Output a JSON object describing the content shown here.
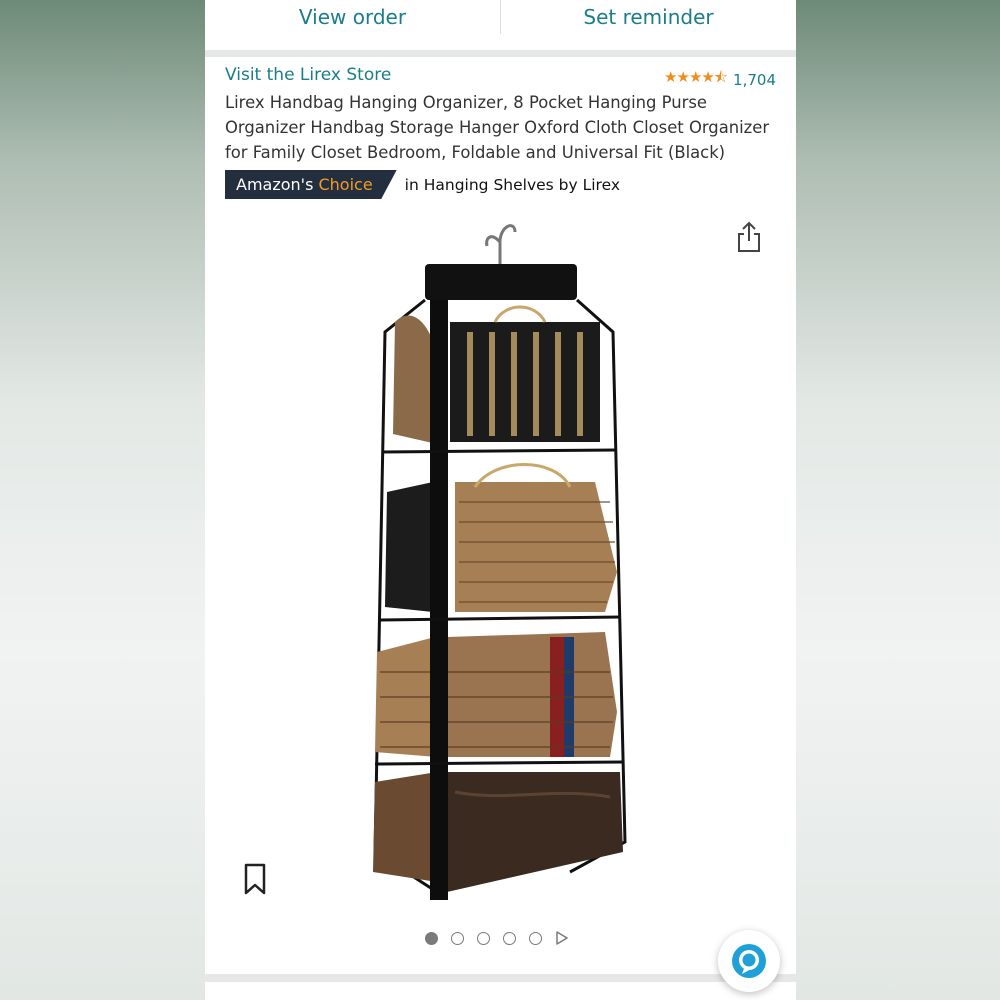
{
  "order_bar": {
    "view_order_label": "View order",
    "set_reminder_label": "Set reminder"
  },
  "product": {
    "store_link": "Visit the Lirex Store",
    "rating_stars": "★★★★⯪",
    "rating_value": 4.5,
    "rating_count": "1,704",
    "title": "Lirex Handbag Hanging Organizer, 8 Pocket Hanging Purse Organizer Handbag Storage Hanger Oxford Cloth Closet Organizer for Family Closet Bedroom, Foldable and Universal Fit (Black)",
    "badge_prefix": "Amazon's ",
    "badge_highlight": "Choice",
    "badge_category": "in Hanging Shelves by Lirex"
  },
  "carousel": {
    "total_images": 5,
    "active_index": 0,
    "has_video": true
  },
  "colors": {
    "link": "#1a7d8a",
    "star": "#f08c1e",
    "badge_bg": "#232f3e",
    "badge_highlight": "#f49b25",
    "alexa": "#1fa0d8"
  },
  "icons": [
    "share-icon",
    "bookmark-icon",
    "play-icon",
    "alexa-icon",
    "star-icon"
  ]
}
